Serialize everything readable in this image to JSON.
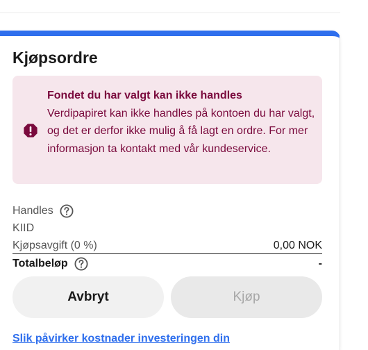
{
  "order": {
    "title": "Kjøpsordre"
  },
  "alert": {
    "title": "Fondet du har valgt kan ikke handles",
    "body": "Verdipapiret kan ikke handles på kontoen du har valgt, og det er derfor ikke mulig å få lagt en ordre. For mer informasjon ta kontakt med vår kundeservice.",
    "icon": "exclamation-circle-icon",
    "color": "#7a0a3d",
    "background": "#f6e6ec"
  },
  "details": {
    "handles_label": "Handles",
    "kiid_label": "KIID",
    "fee_label": "Kjøpsavgift (0 %)",
    "fee_value": "0,00 NOK",
    "total_label": "Totalbeløp",
    "total_value": "-"
  },
  "buttons": {
    "cancel_label": "Avbryt",
    "buy_label": "Kjøp"
  },
  "link": {
    "costs_label": "Slik påvirker kostnader investeringen din"
  },
  "colors": {
    "accent": "#2f6fed",
    "text": "#1a1a1a",
    "muted": "#555555"
  }
}
